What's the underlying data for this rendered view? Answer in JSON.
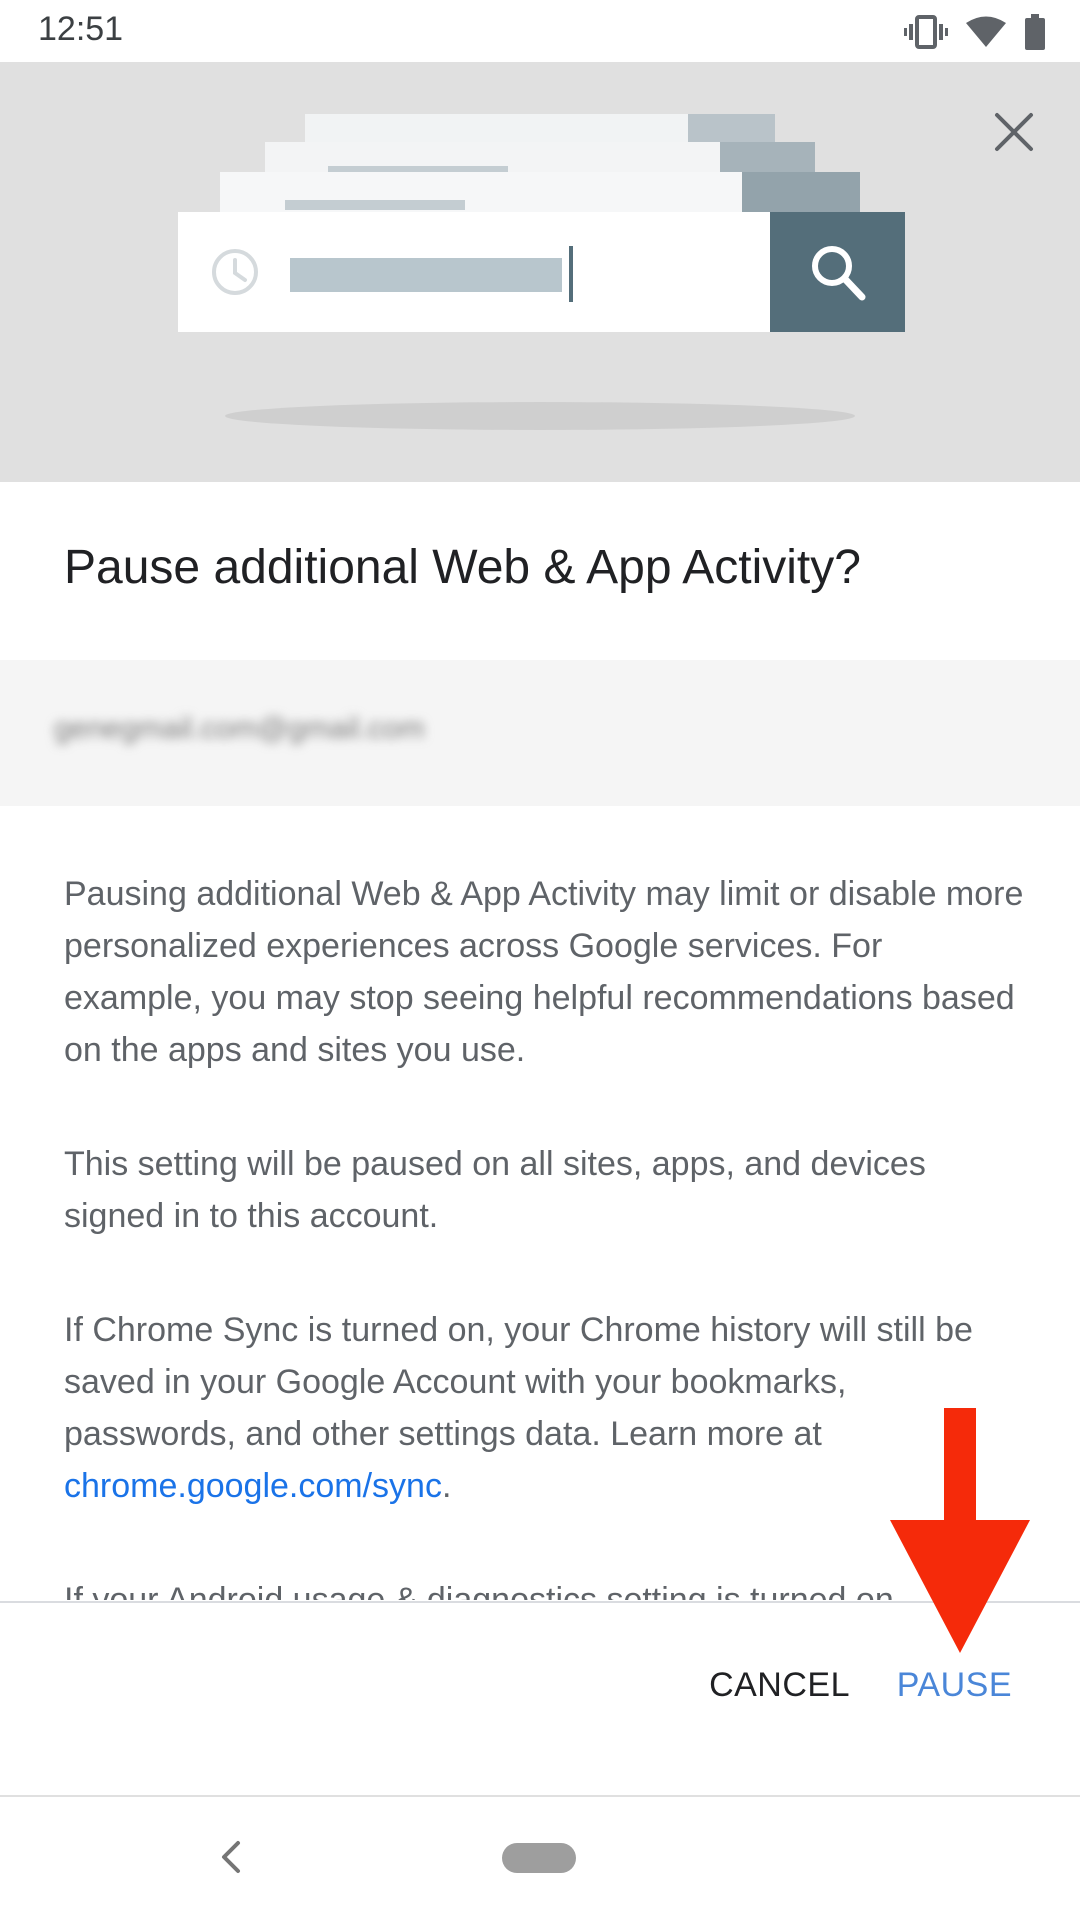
{
  "status_bar": {
    "time": "12:51",
    "icons": [
      "vibrate-icon",
      "wifi-icon",
      "battery-icon"
    ]
  },
  "header": {
    "illustration": "search-history-illustration",
    "close_icon": "close-icon"
  },
  "dialog": {
    "title": "Pause additional Web & App Activity?",
    "account_email": "genegmail.com@gmail.com",
    "paragraphs": {
      "p1": "Pausing additional Web & App Activity may limit or disable more personalized experiences across Google services. For example, you may stop seeing helpful recommendations based on the apps and sites you use.",
      "p2": "This setting will be paused on all sites, apps, and devices signed in to this account.",
      "p3_text": "If Chrome Sync is turned on, your Chrome history will still be saved in your Google Account with your bookmarks, passwords, and other settings data. Learn more at ",
      "p3_link": "chrome.google.com/sync",
      "p3_end": ".",
      "p4": "If your Android usage & diagnostics setting is turned on"
    },
    "buttons": {
      "cancel": "CANCEL",
      "pause": "PAUSE"
    }
  },
  "annotation": {
    "arrow_color": "#f52a0a",
    "points_to": "pause-button"
  },
  "colors": {
    "accent": "#4a86d8",
    "link": "#1a73e8",
    "header_bg": "#e0e0e0",
    "search_button": "#546e7a"
  },
  "nav_bar": {
    "back_icon": "back-chevron-icon",
    "home_icon": "home-pill-icon"
  }
}
